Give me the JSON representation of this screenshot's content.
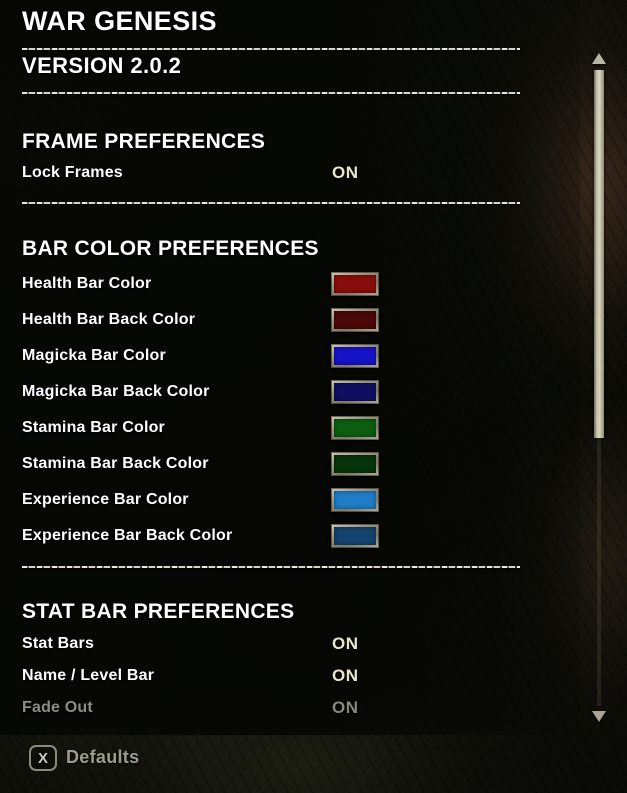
{
  "window": {
    "title": "WAR GENESIS",
    "version": "VERSION 2.0.2"
  },
  "sections": [
    {
      "id": "frame-preferences",
      "heading": "FRAME PREFERENCES",
      "rows": [
        {
          "label": "Lock Frames",
          "type": "toggle",
          "value": "ON",
          "enabled": true
        }
      ]
    },
    {
      "id": "bar-color-preferences",
      "heading": "BAR COLOR PREFERENCES",
      "rows": [
        {
          "label": "Health Bar Color",
          "type": "color",
          "color": "#8a0c0c",
          "enabled": true
        },
        {
          "label": "Health Bar Back Color",
          "type": "color",
          "color": "#4a0808",
          "enabled": true
        },
        {
          "label": "Magicka Bar Color",
          "type": "color",
          "color": "#1512c8",
          "enabled": true
        },
        {
          "label": "Magicka Bar Back Color",
          "type": "color",
          "color": "#0d1060",
          "enabled": true
        },
        {
          "label": "Stamina Bar Color",
          "type": "color",
          "color": "#0c5d12",
          "enabled": true
        },
        {
          "label": "Stamina Bar Back Color",
          "type": "color",
          "color": "#06330a",
          "enabled": true
        },
        {
          "label": "Experience Bar Color",
          "type": "color",
          "color": "#1f7cc6",
          "enabled": true
        },
        {
          "label": "Experience Bar Back Color",
          "type": "color",
          "color": "#14436e",
          "enabled": true
        }
      ]
    },
    {
      "id": "stat-bar-preferences",
      "heading": "STAT BAR PREFERENCES",
      "rows": [
        {
          "label": "Stat Bars",
          "type": "toggle",
          "value": "ON",
          "enabled": true
        },
        {
          "label": "Name / Level Bar",
          "type": "toggle",
          "value": "ON",
          "enabled": true
        },
        {
          "label": "Fade Out",
          "type": "toggle",
          "value": "ON",
          "enabled": false
        }
      ]
    }
  ],
  "scrollbar": {
    "up_arrow_icon": "triangle-up-icon",
    "down_arrow_icon": "triangle-down-icon"
  },
  "footer": {
    "keybind": "X",
    "keybind_label": "Defaults"
  },
  "colors": {
    "title_text": "#ffffff",
    "value_text": "#e9e6cf",
    "disabled_text": "#8d8d83",
    "divider": "#f6f4ec",
    "scrollbar_thumb": "#d8d4bd"
  }
}
